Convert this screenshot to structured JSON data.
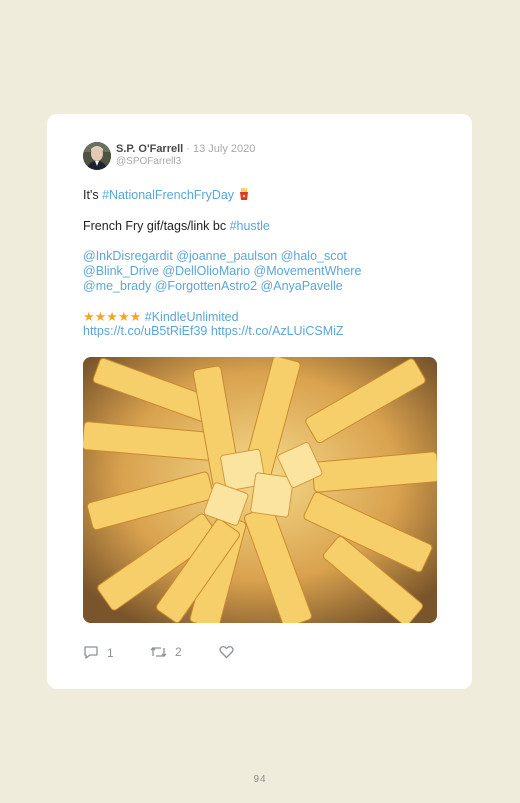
{
  "tweet": {
    "author_name": "S.P. O'Farrell",
    "separator": " · ",
    "date": "13 July 2020",
    "handle": "@SPOFarrell3",
    "line1_prefix": "It's ",
    "line1_hashtag": "#NationalFrenchFryDay",
    "line2_text": "French Fry gif/tags/link bc ",
    "line2_hashtag": "#hustle",
    "mentions_line1": "@InkDisregardit @joanne_paulson @halo_scot",
    "mentions_line2": "@Blink_Drive @DellOlioMario @MovementWhere",
    "mentions_line3": "@me_brady @ForgottenAstro2 @AnyaPavelle",
    "stars": "★★★★★",
    "hashtag_kindle": "#KindleUnlimited",
    "links": "https://t.co/uB5tRiEf39 https://t.co/AzLUiCSMiZ",
    "replies_count": "1",
    "retweets_count": "2",
    "media_subject": "french fries"
  },
  "footer": {
    "page_number": "94"
  },
  "icons": {
    "emoji": "french-fries-emoji",
    "reply": "reply-icon",
    "retweet": "retweet-icon",
    "like": "heart-icon"
  },
  "colors": {
    "background": "#efecdb",
    "card": "#ffffff",
    "link": "#5aa6d8",
    "stars": "#f4a623"
  }
}
